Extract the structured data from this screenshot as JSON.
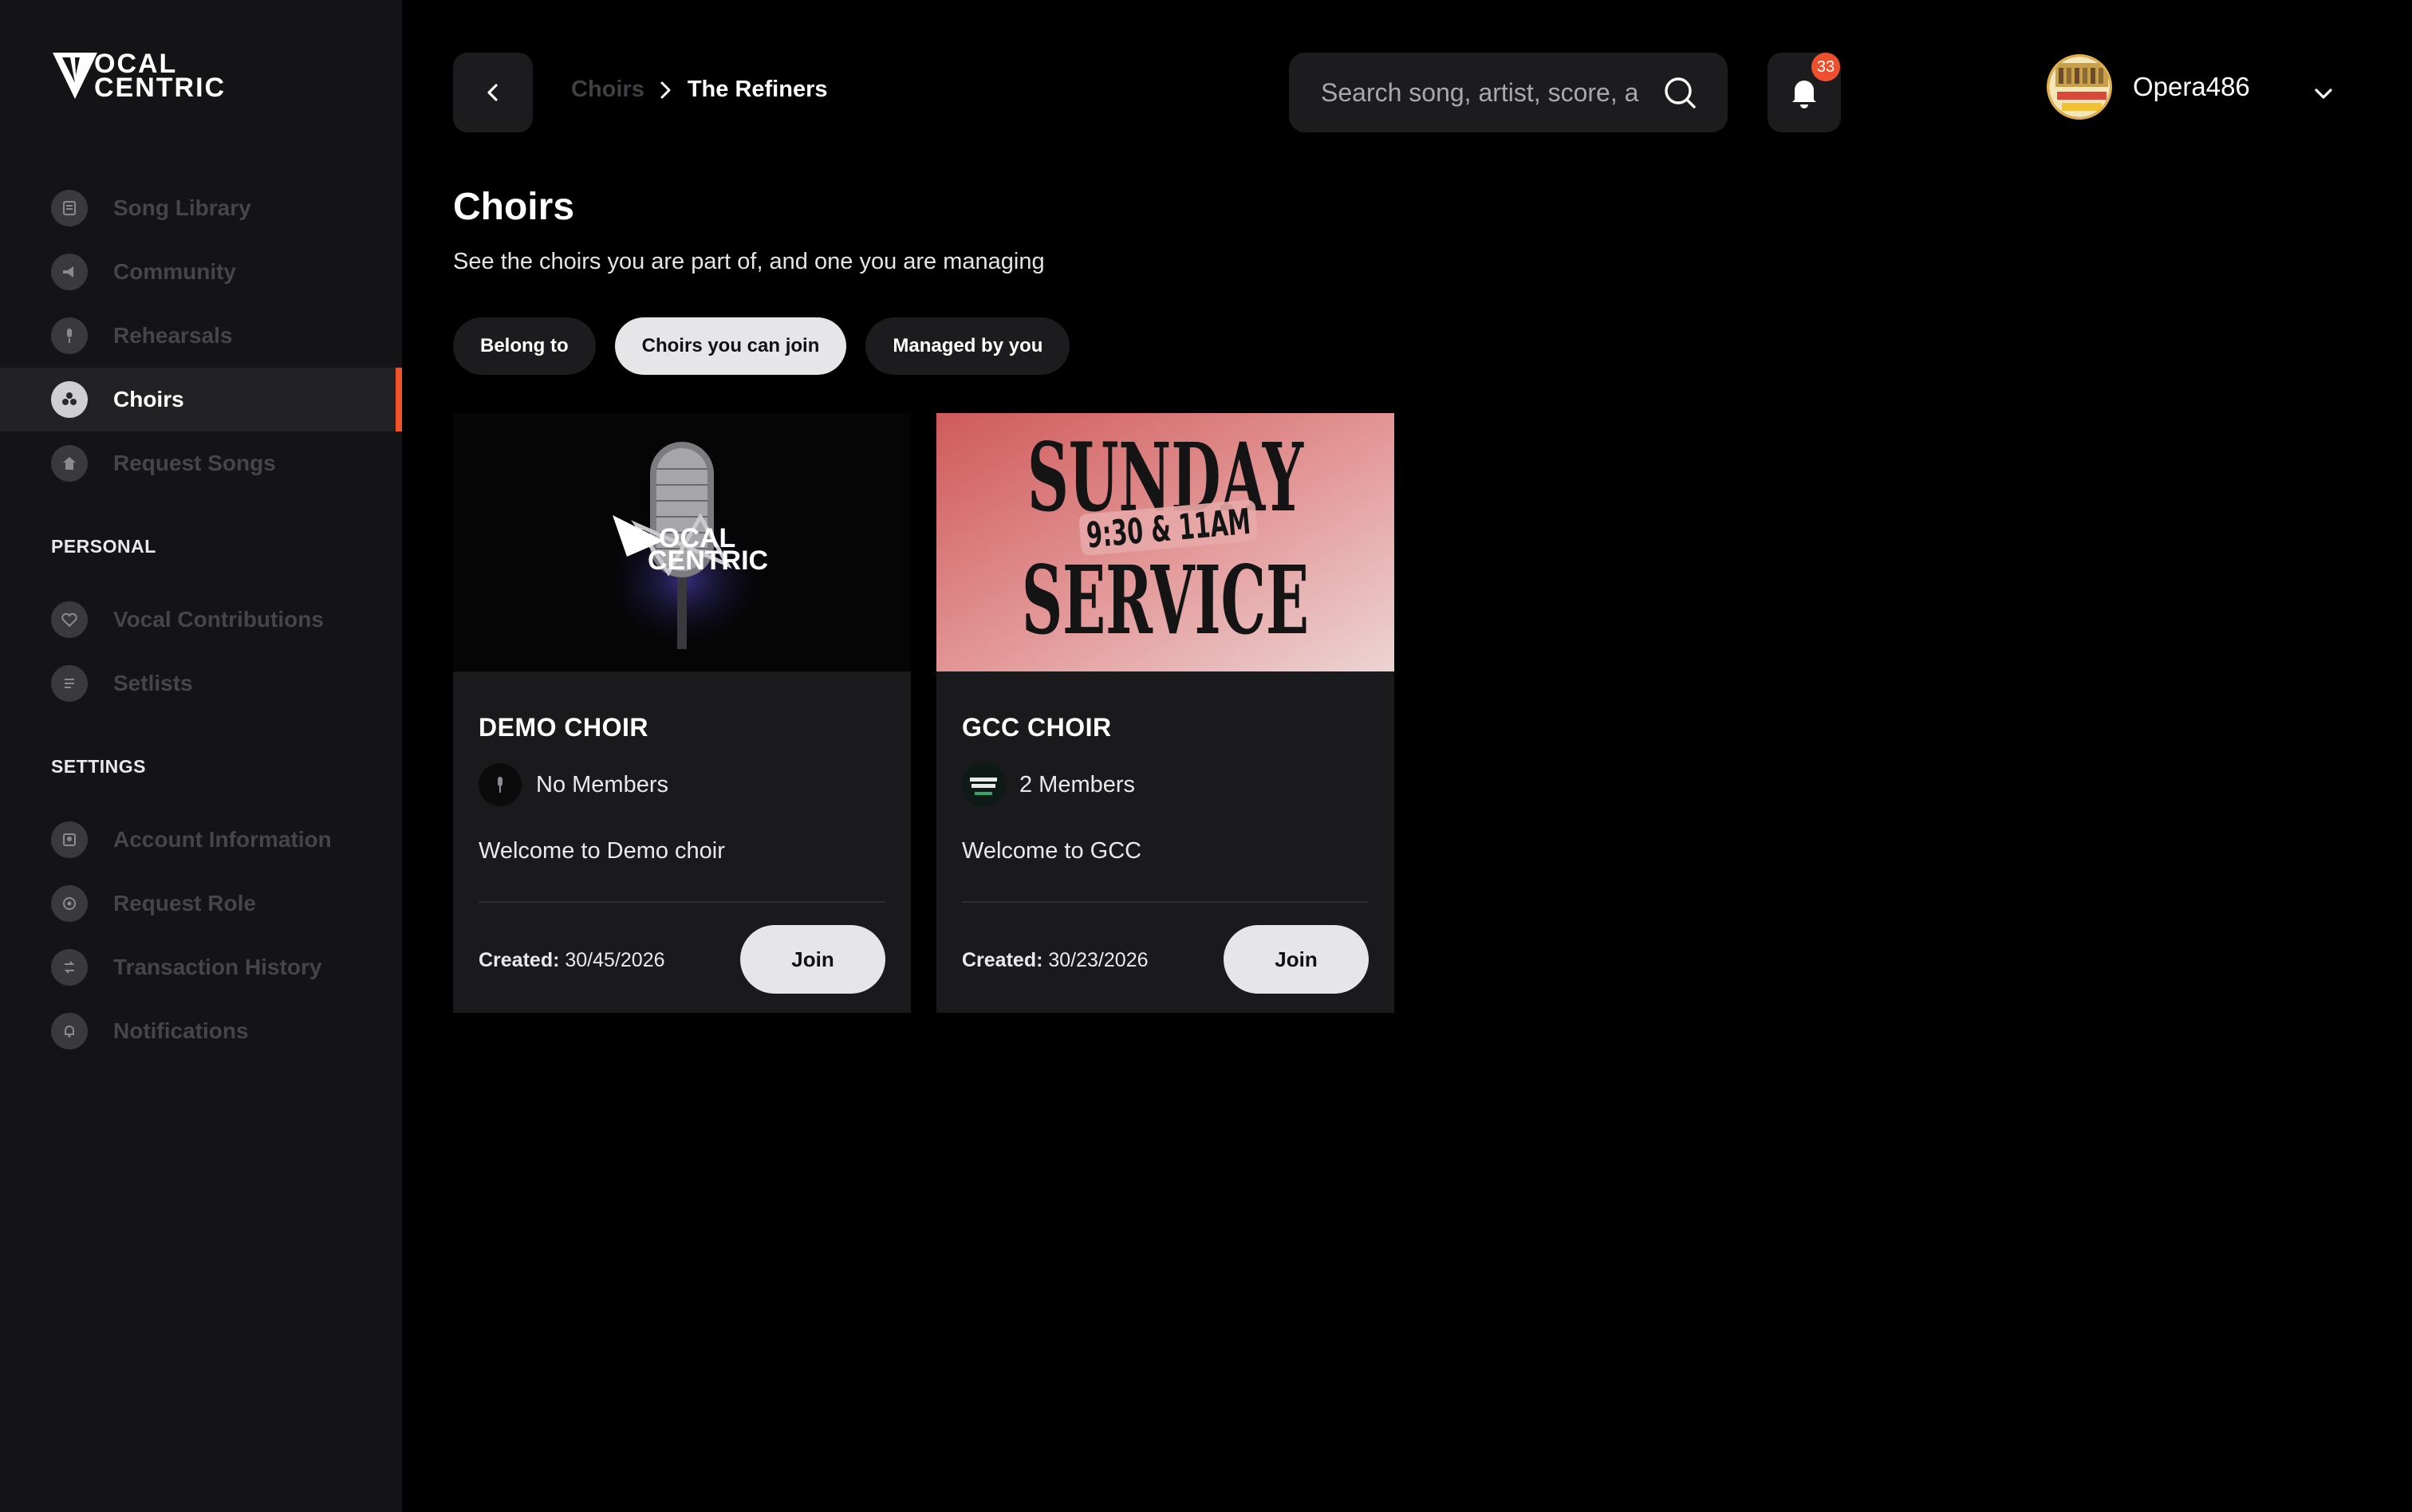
{
  "app": {
    "logo_line1": "OCAL",
    "logo_line2": "CENTRIC"
  },
  "sidebar": {
    "main_items": [
      {
        "label": "Song Library",
        "icon": "song-library-icon"
      },
      {
        "label": "Community",
        "icon": "megaphone-icon"
      },
      {
        "label": "Rehearsals",
        "icon": "microphone-icon"
      },
      {
        "label": "Choirs",
        "icon": "group-icon",
        "active": true
      },
      {
        "label": "Request Songs",
        "icon": "request-icon"
      }
    ],
    "personal_title": "PERSONAL",
    "personal_items": [
      {
        "label": "Vocal Contributions",
        "icon": "heart-icon"
      },
      {
        "label": "Setlists",
        "icon": "setlist-icon"
      }
    ],
    "settings_title": "SETTINGS",
    "settings_items": [
      {
        "label": "Account Information",
        "icon": "account-icon"
      },
      {
        "label": "Request Role",
        "icon": "role-icon"
      },
      {
        "label": "Transaction History",
        "icon": "transaction-icon"
      },
      {
        "label": "Notifications",
        "icon": "bell-icon"
      }
    ],
    "accent_color": "#f0522a"
  },
  "header": {
    "breadcrumb_prev": "Choirs",
    "breadcrumb_current": "The Refiners",
    "search_placeholder": "Search song, artist, score, a",
    "notification_count": "33",
    "username": "Opera486"
  },
  "main": {
    "title": "Choirs",
    "subtitle": "See the choirs you are part of, and one you are managing",
    "tabs": [
      {
        "label": "Belong to"
      },
      {
        "label": "Choirs you can join",
        "active": true
      },
      {
        "label": "Managed by you"
      }
    ],
    "cards": [
      {
        "title": "DEMO CHOIR",
        "members": "No Members",
        "description": "Welcome to Demo choir",
        "created_label": "Created:",
        "created_date": "30/45/2026",
        "join_label": "Join",
        "image_text_1": "OCAL",
        "image_text_2": "CENTRIC"
      },
      {
        "title": "GCC CHOIR",
        "members": "2 Members",
        "description": "Welcome to GCC",
        "created_label": "Created:",
        "created_date": "30/23/2026",
        "join_label": "Join",
        "image_text_1": "SUNDAY",
        "image_text_2": "9:30 & 11AM",
        "image_text_3": "SERVICE"
      }
    ]
  }
}
